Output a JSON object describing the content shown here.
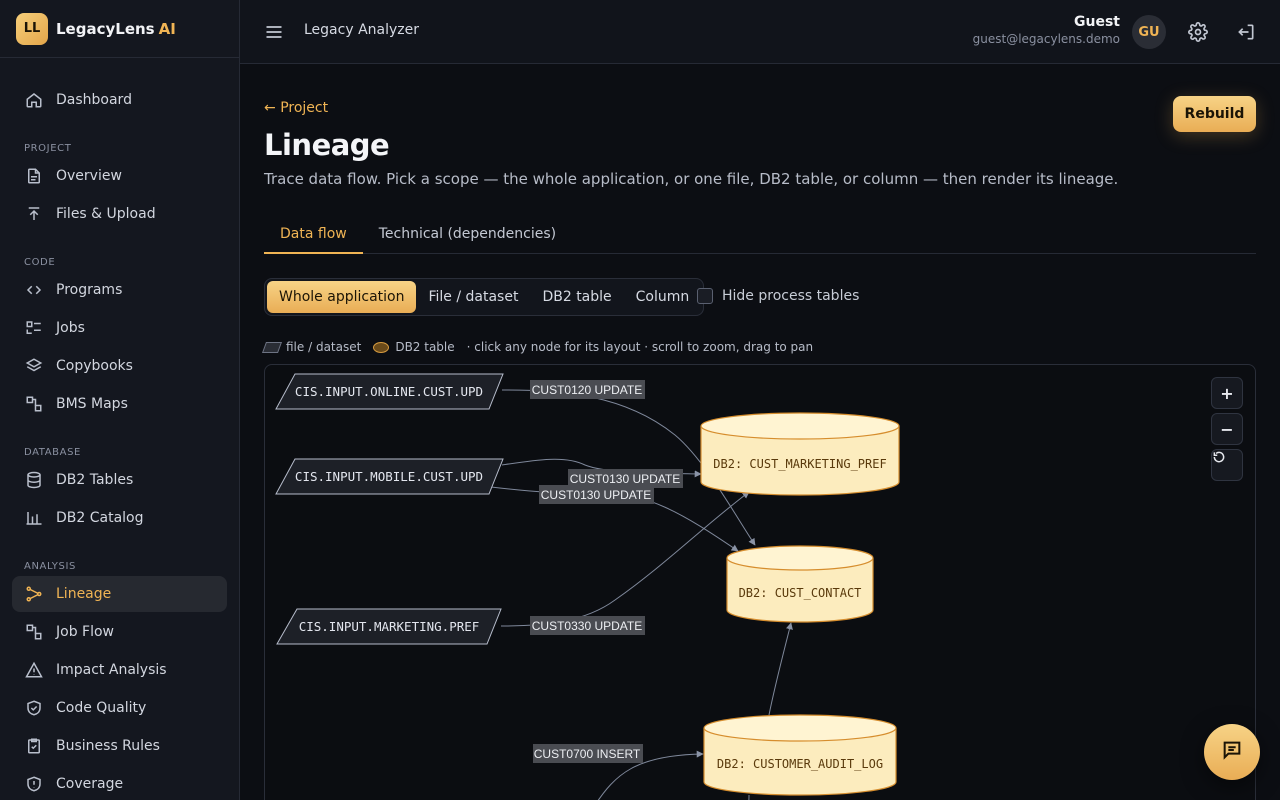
{
  "brand": {
    "logo": "LL",
    "name": "LegacyLens",
    "ai": "AI"
  },
  "nav": {
    "dashboard": "Dashboard",
    "sections": {
      "project": "PROJECT",
      "code": "CODE",
      "database": "DATABASE",
      "analysis": "ANALYSIS"
    },
    "project": [
      "Overview",
      "Files & Upload"
    ],
    "code": [
      "Programs",
      "Jobs",
      "Copybooks",
      "BMS Maps"
    ],
    "database": [
      "DB2 Tables",
      "DB2 Catalog"
    ],
    "analysis": [
      "Lineage",
      "Job Flow",
      "Impact Analysis",
      "Code Quality",
      "Business Rules",
      "Coverage"
    ]
  },
  "topbar": {
    "title": "Legacy Analyzer",
    "user_name": "Guest",
    "user_email": "guest@legacylens.demo",
    "avatar": "GU"
  },
  "page": {
    "back": "Project",
    "title": "Lineage",
    "subtitle": "Trace data flow. Pick a scope — the whole application, or one file, DB2 table, or column — then render its lineage.",
    "rebuild": "Rebuild"
  },
  "tabs": [
    "Data flow",
    "Technical (dependencies)"
  ],
  "scope": [
    "Whole application",
    "File / dataset",
    "DB2 table",
    "Column"
  ],
  "hide_process_tables": "Hide process tables",
  "legend": {
    "file": "file / dataset",
    "db2": "DB2 table",
    "hint": "· click any node for its layout · scroll to zoom, drag to pan"
  },
  "graph": {
    "files": [
      "CIS.INPUT.ONLINE.CUST.UPD",
      "CIS.INPUT.MOBILE.CUST.UPD",
      "CIS.INPUT.MARKETING.PREF"
    ],
    "tables": [
      "DB2: CUST_MARKETING_PREF",
      "DB2: CUST_CONTACT",
      "DB2: CUSTOMER_AUDIT_LOG"
    ],
    "edge_labels": [
      "CUST0120 UPDATE",
      "CUST0130 UPDATE",
      "CUST0130 UPDATE",
      "CUST0330 UPDATE",
      "CUST0700 INSERT"
    ]
  },
  "zoom": {
    "in": "+",
    "out": "−"
  }
}
